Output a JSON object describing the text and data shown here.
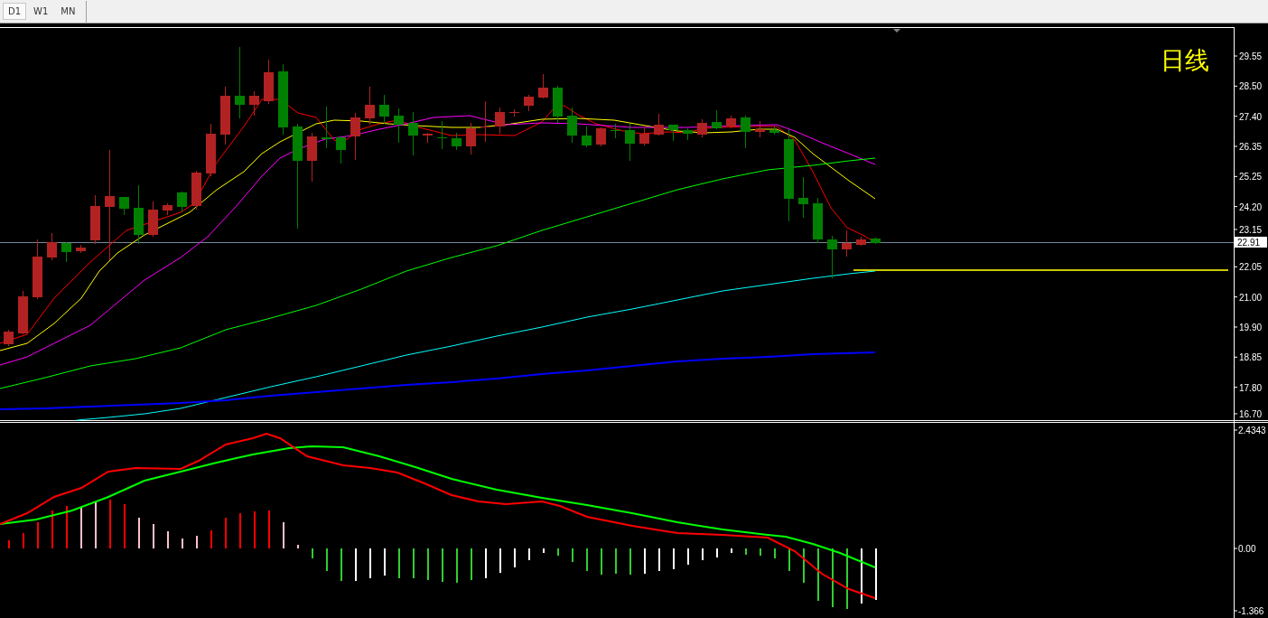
{
  "toolbar": {
    "tabs": [
      {
        "label": "D1",
        "selected": true
      },
      {
        "label": "W1",
        "selected": false
      },
      {
        "label": "MN",
        "selected": false
      }
    ]
  },
  "main_chart": {
    "title": "日线",
    "price_ticks": [
      "29.55",
      "28.50",
      "27.40",
      "26.35",
      "25.25",
      "24.20",
      "23.15",
      "22.05",
      "21.00",
      "19.90",
      "18.85",
      "17.80",
      "16.70"
    ],
    "current_price": "22.91"
  },
  "indicator_panel": {
    "ticks": [
      "2.4343",
      "0.00",
      "-1.366"
    ]
  }
}
